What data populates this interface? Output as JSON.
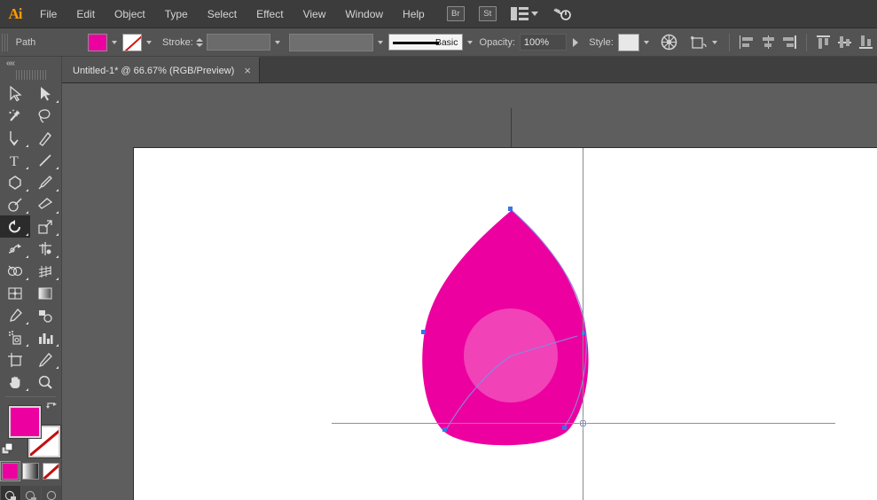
{
  "app": {
    "name": "Adobe Illustrator",
    "logo_text": "Ai"
  },
  "menubar": {
    "items": [
      {
        "label": "File"
      },
      {
        "label": "Edit"
      },
      {
        "label": "Object"
      },
      {
        "label": "Type"
      },
      {
        "label": "Select"
      },
      {
        "label": "Effect"
      },
      {
        "label": "View"
      },
      {
        "label": "Window"
      },
      {
        "label": "Help"
      }
    ],
    "bridge_label": "Br",
    "stock_label": "St",
    "arrange_icon": "arrange-documents-icon",
    "workspace_chevron": "chevron-down-icon",
    "search_icon": "search-adobe-stock-icon"
  },
  "controlbar": {
    "object_type": "Path",
    "fill_label": "fill-swatch",
    "fill_color": "#EC00A0",
    "stroke_swatch_label": "stroke-none-swatch",
    "stroke_label": "Stroke:",
    "stroke_weight": "",
    "variable_width_profile": "",
    "brush_definition": "Basic",
    "opacity_label": "Opacity:",
    "opacity_value": "100%",
    "style_label": "Style:",
    "recolor_icon": "recolor-artwork-icon",
    "transform_icon": "transform-icon",
    "align_icons": [
      "align-left-icon",
      "align-horizontal-center-icon",
      "align-right-icon",
      "align-top-icon",
      "align-vertical-center-icon",
      "align-bottom-icon"
    ]
  },
  "tabbar": {
    "document_title": "Untitled-1* @ 66.67% (RGB/Preview)",
    "close_glyph": "×"
  },
  "toolbar": {
    "collapse_glyph": "««",
    "tools": [
      {
        "name": "selection-tool",
        "active": false,
        "corner": false
      },
      {
        "name": "direct-selection-tool",
        "active": false,
        "corner": true
      },
      {
        "name": "magic-wand-tool",
        "active": false,
        "corner": false
      },
      {
        "name": "lasso-tool",
        "active": false,
        "corner": false
      },
      {
        "name": "pen-tool",
        "active": false,
        "corner": true
      },
      {
        "name": "curvature-tool",
        "active": false,
        "corner": false
      },
      {
        "name": "type-tool",
        "active": false,
        "corner": true
      },
      {
        "name": "line-segment-tool",
        "active": false,
        "corner": true
      },
      {
        "name": "rectangle-tool",
        "active": false,
        "corner": true
      },
      {
        "name": "paintbrush-tool",
        "active": false,
        "corner": true
      },
      {
        "name": "shaper-tool",
        "active": false,
        "corner": true
      },
      {
        "name": "eraser-tool",
        "active": false,
        "corner": true
      },
      {
        "name": "rotate-tool",
        "active": true,
        "corner": true
      },
      {
        "name": "scale-tool",
        "active": false,
        "corner": true
      },
      {
        "name": "width-tool",
        "active": false,
        "corner": true
      },
      {
        "name": "free-transform-tool",
        "active": false,
        "corner": true
      },
      {
        "name": "shape-builder-tool",
        "active": false,
        "corner": true
      },
      {
        "name": "perspective-grid-tool",
        "active": false,
        "corner": true
      },
      {
        "name": "mesh-tool",
        "active": false,
        "corner": false
      },
      {
        "name": "gradient-tool",
        "active": false,
        "corner": false
      },
      {
        "name": "eyedropper-tool",
        "active": false,
        "corner": true
      },
      {
        "name": "blend-tool",
        "active": false,
        "corner": false
      },
      {
        "name": "symbol-sprayer-tool",
        "active": false,
        "corner": true
      },
      {
        "name": "column-graph-tool",
        "active": false,
        "corner": true
      },
      {
        "name": "artboard-tool",
        "active": false,
        "corner": false
      },
      {
        "name": "slice-tool",
        "active": false,
        "corner": true
      },
      {
        "name": "hand-tool",
        "active": false,
        "corner": true
      },
      {
        "name": "zoom-tool",
        "active": false,
        "corner": false
      }
    ],
    "fill_color": "#EC00A0",
    "stroke_color": "none",
    "swap_icon": "swap-fill-stroke-icon",
    "default_icon": "default-fill-stroke-icon",
    "color_modes": [
      {
        "name": "color-mode-button",
        "selected": true
      },
      {
        "name": "gradient-mode-button",
        "selected": false
      },
      {
        "name": "none-mode-button",
        "selected": false
      }
    ],
    "screen_modes": [
      {
        "name": "normal-screen-mode-button",
        "active": true
      },
      {
        "name": "full-screen-menubar-mode-button",
        "active": false
      },
      {
        "name": "full-screen-mode-button",
        "active": false
      }
    ]
  },
  "canvas": {
    "artboard_background": "#ffffff",
    "canvas_background": "#5e5e5e",
    "shape": {
      "name": "reuleaux-triangle-path",
      "fill": "#EC00A0",
      "rotation_origin": "center",
      "overlay_circle_color": "rgba(255,255,255,0.28)",
      "selection_path_color": "#7a7ae0"
    },
    "guides": {
      "vertical": "vertical-guide",
      "horizontal": "horizontal-guide",
      "color": "#8e8e8e"
    },
    "origin_marker": "rotation-origin-marker"
  }
}
